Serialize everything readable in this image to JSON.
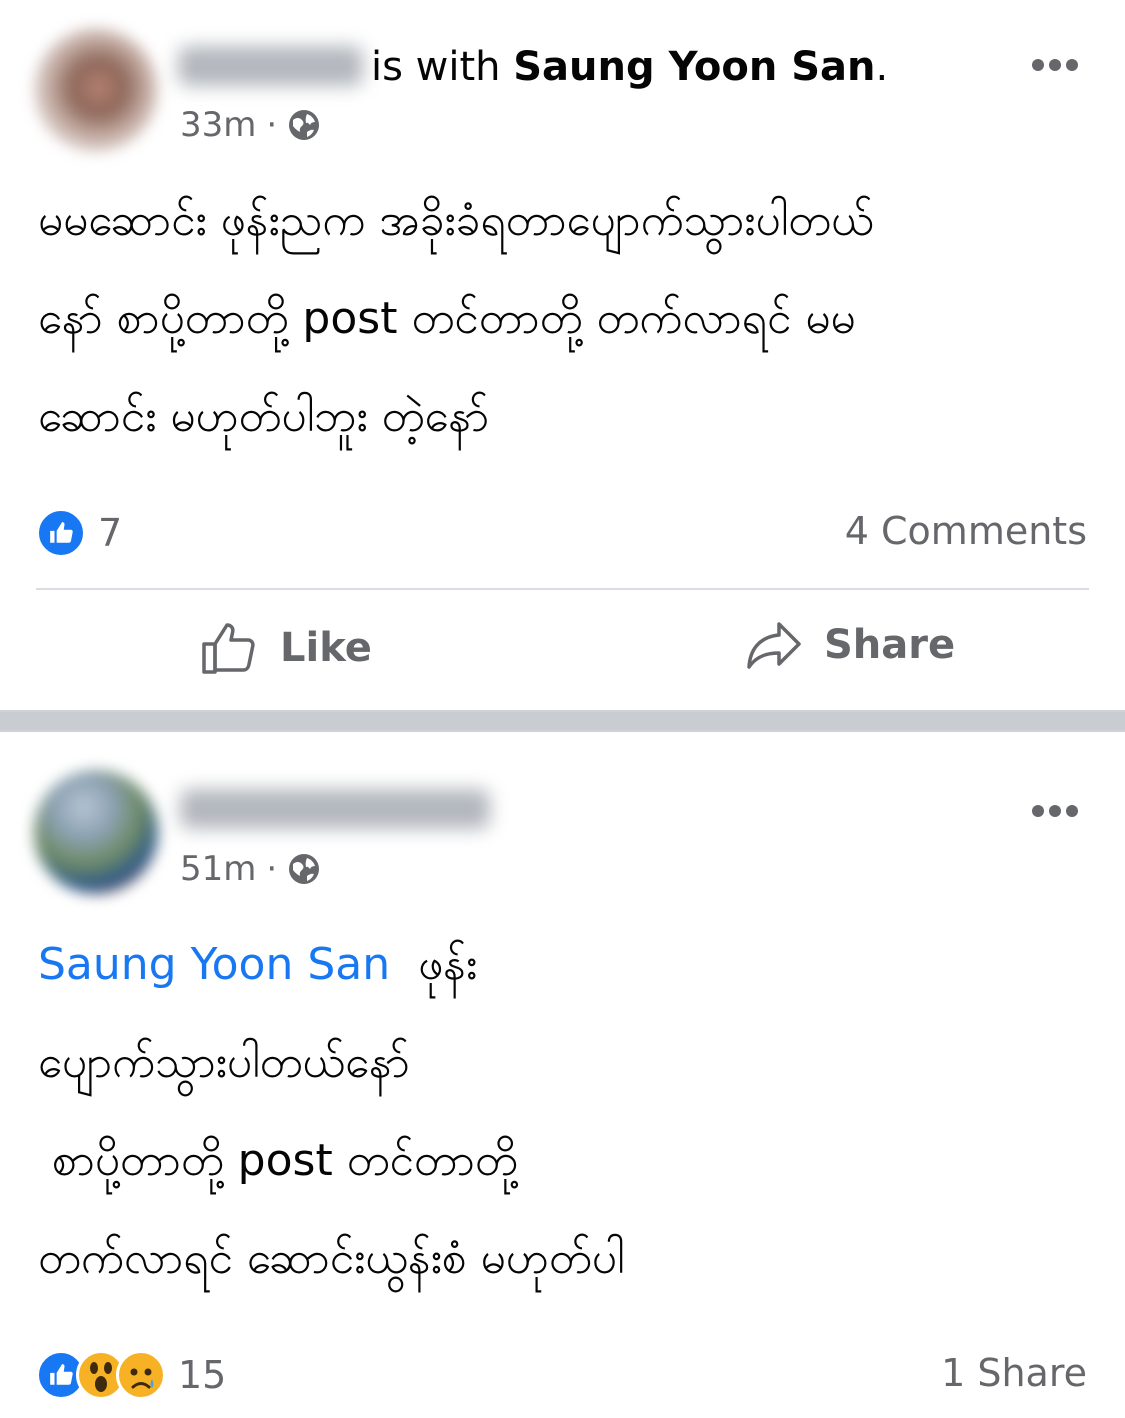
{
  "colors": {
    "link": "#1877f2",
    "secondary": "#65676b",
    "divider": "#c9ccd1"
  },
  "posts": [
    {
      "header": {
        "with_text": "is with",
        "with_name": "Saung Yoon San",
        "period": "."
      },
      "time": "33m",
      "privacy_icon": "globe-icon",
      "body_lines": [
        "မမဆောင်း  ဖုန်းညက အခိုးခံရတာပျောက်သွားပါတယ်",
        "နော် စာပို့တာတို့ post တင်တာတို့ တက်လာရင် မမ",
        "ဆောင်း မဟုတ်ပါဘူး တဲ့နော်"
      ],
      "reaction_count": "7",
      "comments": "4 Comments",
      "actions": {
        "like": "Like",
        "share": "Share"
      }
    },
    {
      "time": "51m",
      "privacy_icon": "globe-icon",
      "mention": "Saung Yoon San",
      "body_lines": [
        "ဖုန်း",
        "ပျောက်သွားပါတယ်နော်",
        " စာပို့တာတို့ post တင်တာတို့",
        "တက်လာရင် ဆောင်းယွန်းစံ မဟုတ်ပါ"
      ],
      "reaction_count": "15",
      "shares": "1 Share"
    }
  ]
}
